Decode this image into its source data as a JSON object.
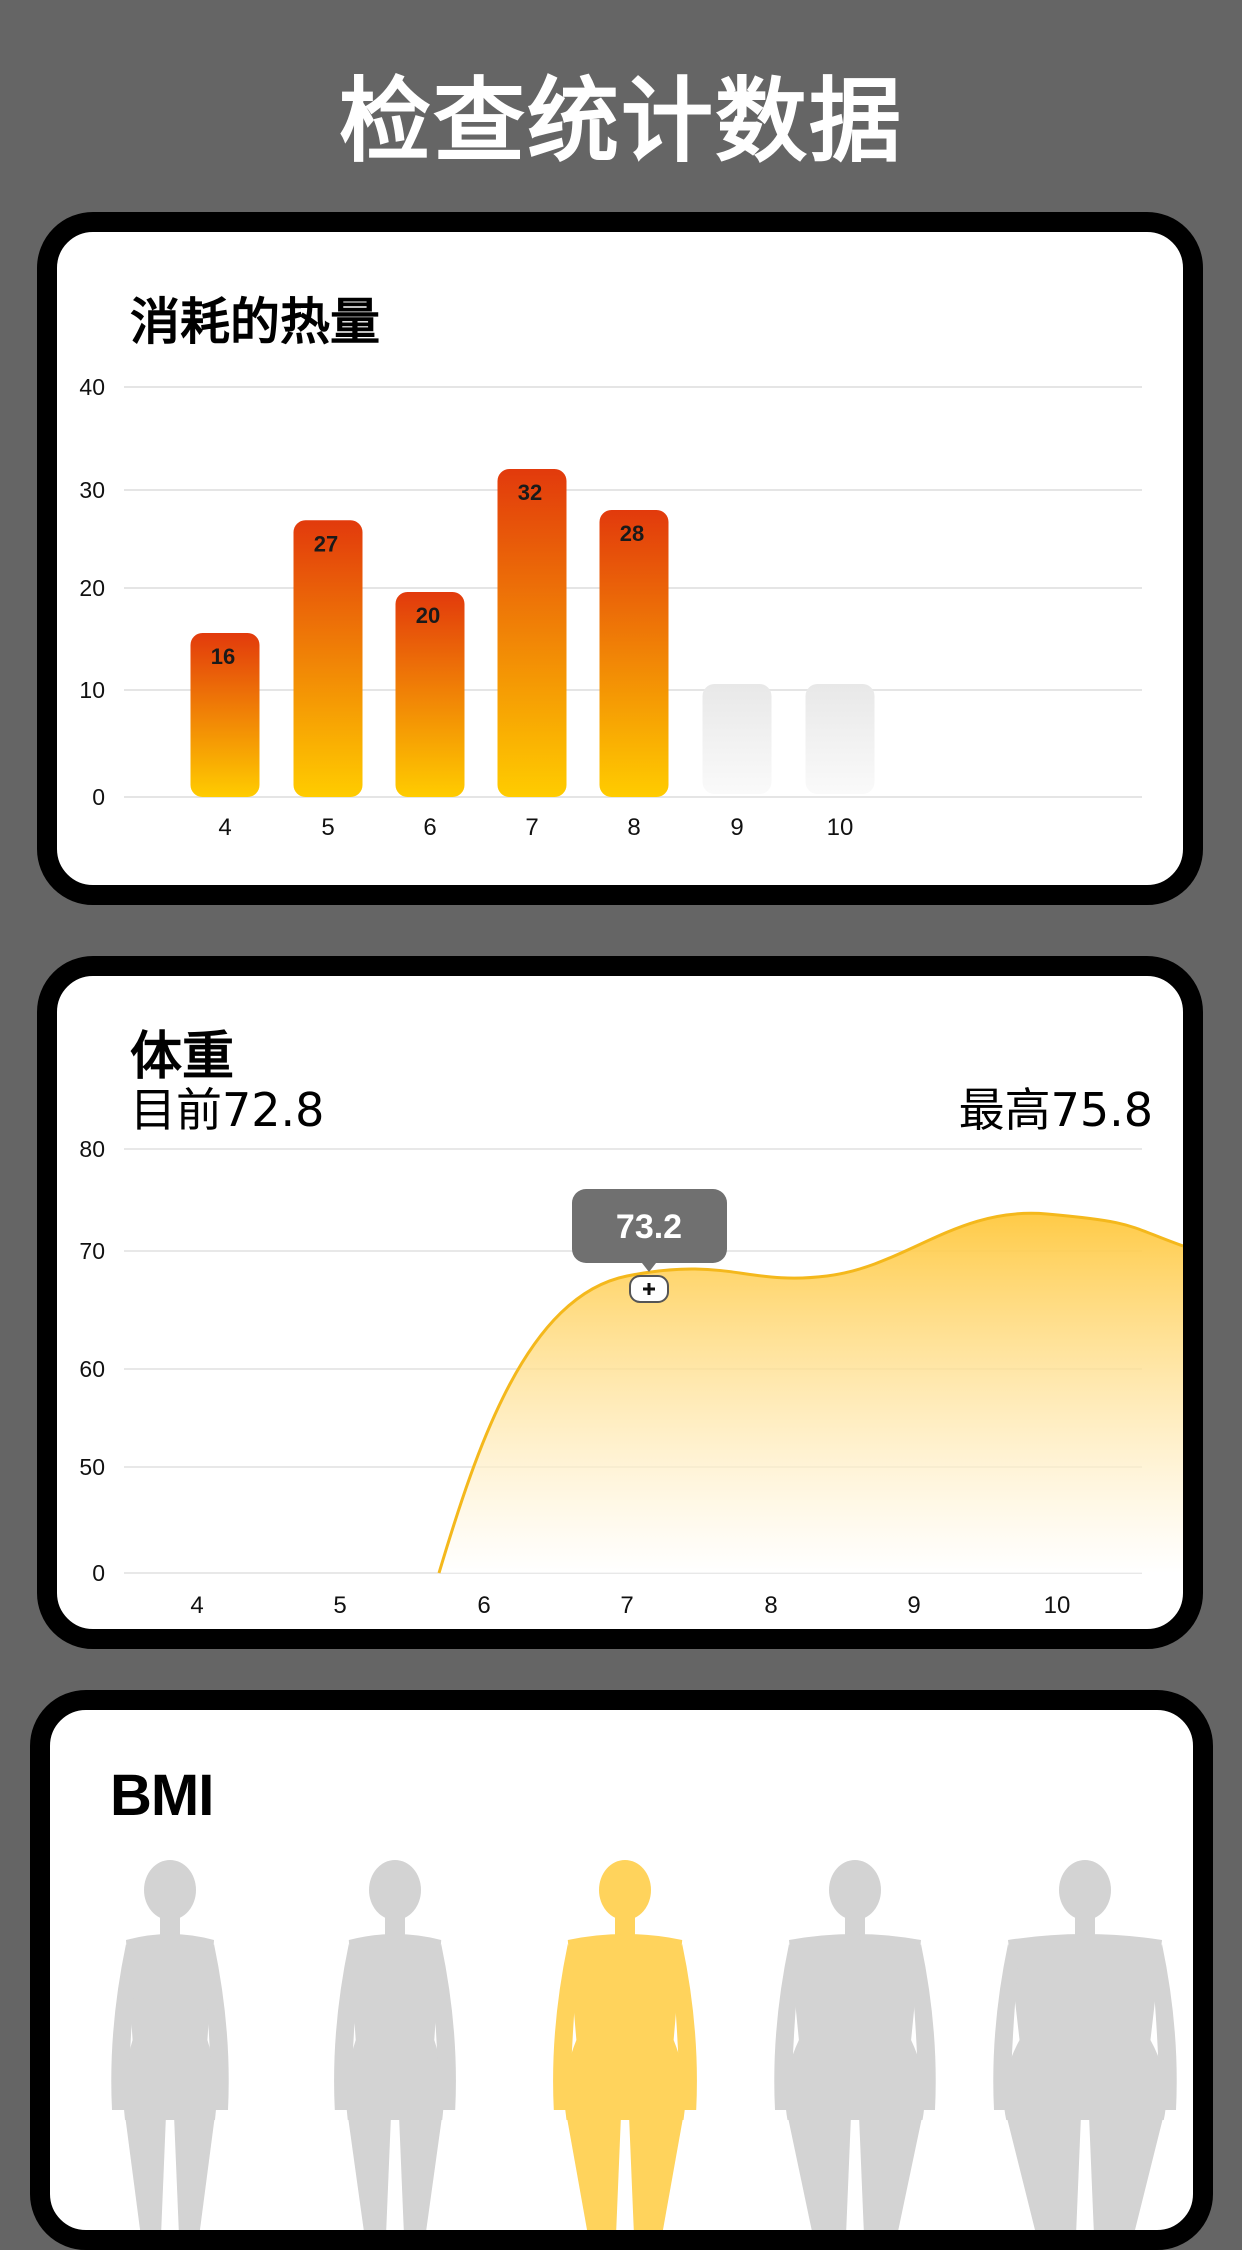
{
  "page_title": "检查统计数据",
  "calories": {
    "title": "消耗的热量",
    "chart_data": {
      "type": "bar",
      "title": "消耗的热量",
      "categories": [
        "4",
        "5",
        "6",
        "7",
        "8",
        "9",
        "10"
      ],
      "values": [
        16,
        27,
        20,
        32,
        28,
        null,
        null
      ],
      "y_ticks": [
        "40",
        "30",
        "20",
        "10",
        "0"
      ],
      "ylim": [
        0,
        40
      ],
      "grid": true,
      "colors": {
        "bar_top": "#E23A0C",
        "bar_bottom": "#FFCC00",
        "placeholder": "#E6E6E6"
      }
    }
  },
  "weight": {
    "title": "体重",
    "current_label": "目前72.8",
    "max_label": "最高75.8",
    "tooltip_value": "73.2",
    "chart_data": {
      "type": "area",
      "title": "体重",
      "categories": [
        "4",
        "5",
        "6",
        "7",
        "8",
        "9",
        "10"
      ],
      "values": [
        null,
        null,
        0,
        73.2,
        71.5,
        74.5,
        75.8
      ],
      "y_ticks": [
        "80",
        "70",
        "60",
        "50",
        "0"
      ],
      "grid": true,
      "colors": {
        "line": "#F4B81C",
        "fill_top": "#FFC83D",
        "fill_bottom": "#FFFFFF"
      }
    }
  },
  "bmi": {
    "title": "BMI",
    "figures": [
      {
        "name": "underweight",
        "highlighted": false
      },
      {
        "name": "normal",
        "highlighted": false
      },
      {
        "name": "overweight",
        "highlighted": true
      },
      {
        "name": "obese",
        "highlighted": false
      },
      {
        "name": "extremely-obese",
        "highlighted": false
      }
    ],
    "colors": {
      "active": "#FFD35C",
      "inactive": "#D3D3D3"
    }
  }
}
